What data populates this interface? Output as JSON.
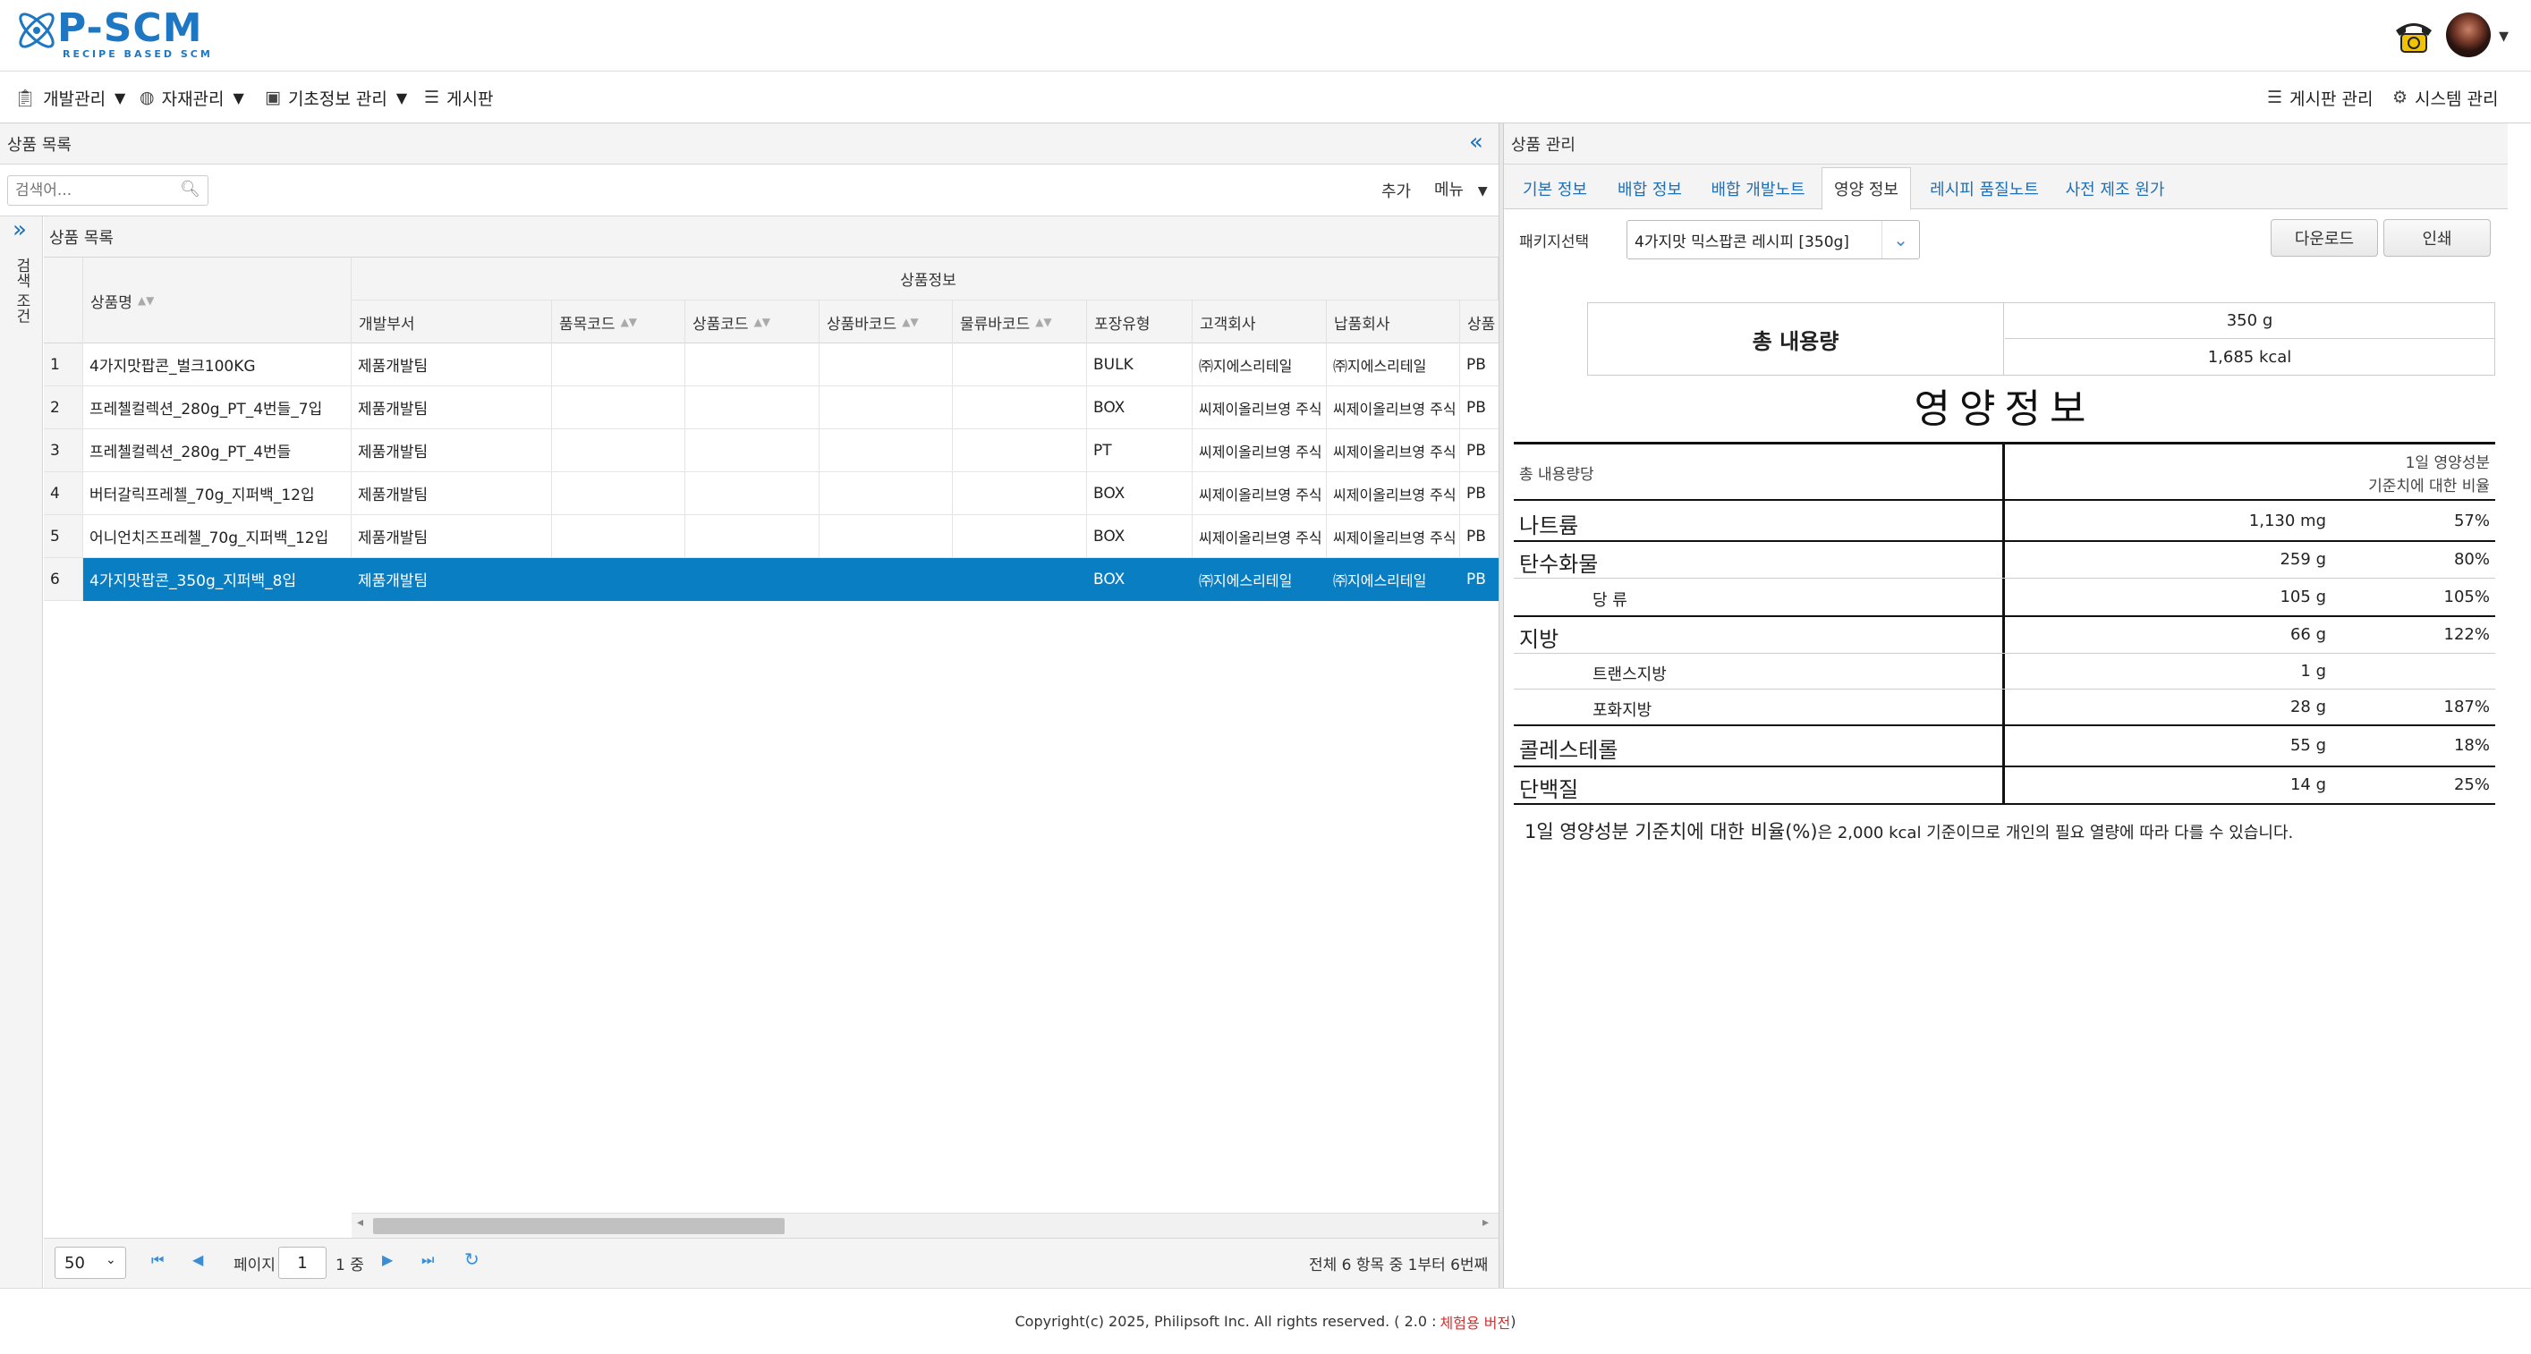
{
  "brand": {
    "name": "P-SCM",
    "tagline": "RECIPE BASED SCM",
    "color": "#1d77c2"
  },
  "menubar": {
    "left": [
      {
        "label": "개발관리",
        "icon": "clipboard-icon"
      },
      {
        "label": "자재관리",
        "icon": "palette-icon"
      },
      {
        "label": "기초정보 관리",
        "icon": "id-card-icon"
      },
      {
        "label": "게시판",
        "icon": "list-icon"
      }
    ],
    "right": [
      {
        "label": "게시판 관리",
        "icon": "list-icon"
      },
      {
        "label": "시스템 관리",
        "icon": "gear-icon"
      }
    ]
  },
  "left_panel": {
    "title": "상품 목록",
    "search_placeholder": "검색어...",
    "add_label": "추가",
    "menu_label": "메뉴",
    "side_label": "검색 조건",
    "grid_title": "상품 목록",
    "group_header": "상품정보",
    "columns": [
      "상품명",
      "개발부서",
      "품목코드",
      "상품코드",
      "상품바코드",
      "물류바코드",
      "포장유형",
      "고객회사",
      "납품회사",
      "상품"
    ],
    "rows": [
      {
        "no": "1",
        "name": "4가지맛팝콘_벌크100KG",
        "dept": "제품개발팀",
        "pack": "BULK",
        "customer": "㈜지에스리테일",
        "supplier": "㈜지에스리테일",
        "type": "PB"
      },
      {
        "no": "2",
        "name": "프레첼컬렉션_280g_PT_4번들_7입",
        "dept": "제품개발팀",
        "pack": "BOX",
        "customer": "씨제이올리브영 주식",
        "supplier": "씨제이올리브영 주식",
        "type": "PB"
      },
      {
        "no": "3",
        "name": "프레첼컬렉션_280g_PT_4번들",
        "dept": "제품개발팀",
        "pack": "PT",
        "customer": "씨제이올리브영 주식",
        "supplier": "씨제이올리브영 주식",
        "type": "PB"
      },
      {
        "no": "4",
        "name": "버터갈릭프레첼_70g_지퍼백_12입",
        "dept": "제품개발팀",
        "pack": "BOX",
        "customer": "씨제이올리브영 주식",
        "supplier": "씨제이올리브영 주식",
        "type": "PB"
      },
      {
        "no": "5",
        "name": "어니언치즈프레첼_70g_지퍼백_12입",
        "dept": "제품개발팀",
        "pack": "BOX",
        "customer": "씨제이올리브영 주식",
        "supplier": "씨제이올리브영 주식",
        "type": "PB"
      },
      {
        "no": "6",
        "name": "4가지맛팝콘_350g_지퍼백_8입",
        "dept": "제품개발팀",
        "pack": "BOX",
        "customer": "㈜지에스리테일",
        "supplier": "㈜지에스리테일",
        "type": "PB"
      }
    ],
    "pager": {
      "page_size": "50",
      "page_label": "페이지",
      "page": "1",
      "of_label": "1 중",
      "summary": "전체 6 항목 중 1부터 6번째"
    }
  },
  "right_panel": {
    "title": "상품 관리",
    "tabs": [
      "기본 정보",
      "배합 정보",
      "배합 개발노트",
      "영양 정보",
      "레시피 품질노트",
      "사전 제조 원가"
    ],
    "package_label": "패키지선택",
    "package_value": "4가지맛 믹스팝콘 레시피 [350g]",
    "download_label": "다운로드",
    "print_label": "인쇄",
    "total_label": "총 내용량",
    "total_weight": "350 g",
    "total_kcal": "1,685 kcal",
    "nutrition_title": "영양정보",
    "per_label": "총 내용량당",
    "daily_label_1": "1일 영양성분",
    "daily_label_2": "기준치에 대한 비율",
    "nutrients": [
      {
        "name": "나트륨",
        "value": "1,130 mg",
        "pct": "57%",
        "major": true
      },
      {
        "name": "탄수화물",
        "value": "259 g",
        "pct": "80%",
        "major": true
      },
      {
        "name": "당 류",
        "value": "105 g",
        "pct": "105%",
        "major": false
      },
      {
        "name": "지방",
        "value": "66 g",
        "pct": "122%",
        "major": true
      },
      {
        "name": "트랜스지방",
        "value": "1 g",
        "pct": "",
        "major": false
      },
      {
        "name": "포화지방",
        "value": "28 g",
        "pct": "187%",
        "major": false
      },
      {
        "name": "콜레스테롤",
        "value": "55 g",
        "pct": "18%",
        "major": true
      },
      {
        "name": "단백질",
        "value": "14 g",
        "pct": "25%",
        "major": true
      }
    ],
    "footnote_bold": "1일 영양성분 기준치에 대한 비율(%)",
    "footnote_rest": "은 2,000 kcal 기준이므로 개인의 필요 열량에 따라 다를 수 있습니다."
  },
  "footer": {
    "copyright": "Copyright(c) 2025, Philipsoft Inc. All rights reserved. ( 2.0 : ",
    "edition": "체험용 버전",
    "close": " )"
  }
}
